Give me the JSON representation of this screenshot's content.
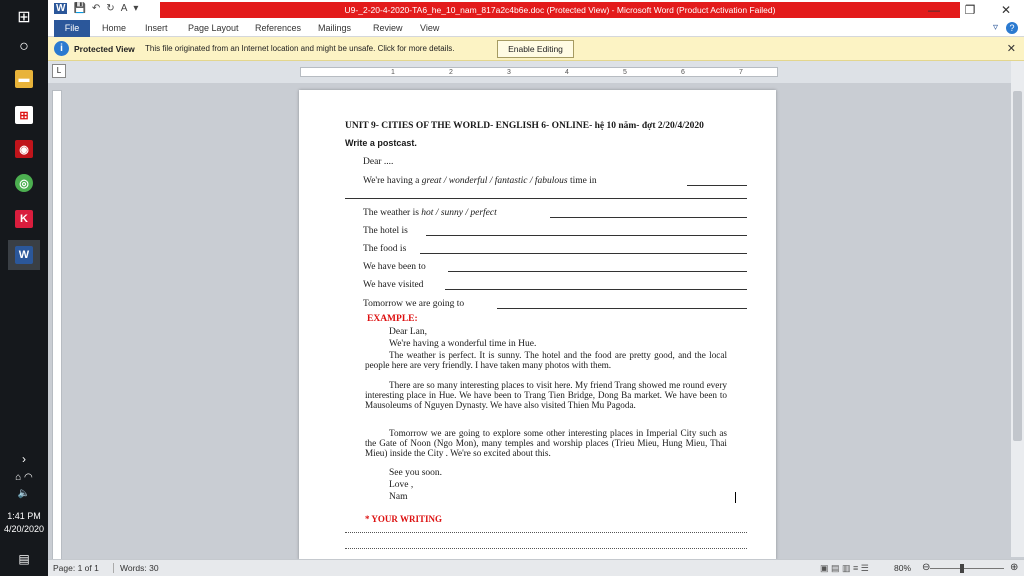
{
  "window": {
    "title": "U9-_2-20-4-2020-TA6_he_10_nam_817a2c4b6e.doc (Protected View) - Microsoft Word (Product Activation Failed)"
  },
  "ribbon": {
    "tabs": [
      "File",
      "Home",
      "Insert",
      "Page Layout",
      "References",
      "Mailings",
      "Review",
      "View"
    ]
  },
  "protected_view": {
    "title": "Protected View",
    "message": "This file originated from an Internet location and might be unsafe. Click for more details.",
    "button": "Enable Editing"
  },
  "ruler": {
    "marks": [
      "1",
      "2",
      "3",
      "4",
      "5",
      "6",
      "7"
    ]
  },
  "document": {
    "heading": "UNIT 9- CITIES OF THE WORLD- ENGLISH 6- ONLINE- hệ 10 năm- đợt 2/20/4/2020",
    "instruction": "Write a postcast.",
    "dear": "Dear ....",
    "having_prefix": "We're having a",
    "having_options": "great / wonderful / fantastic / fabulous",
    "having_suffix": "time in",
    "weather_prefix": "The weather is",
    "weather_options": "hot / sunny / perfect",
    "hotel": "The hotel is",
    "food": "The food is",
    "been_to": "We have been to",
    "visited": "We have visited",
    "tomorrow": "Tomorrow we are going to",
    "example_label": "EXAMPLE:",
    "ex_dear": "Dear Lan,",
    "ex_having": "We're having a  wonderful time in Hue.",
    "ex_para1": "The weather is  perfect. It is sunny. The hotel and the food are pretty good, and the local people here are very friendly. I have taken many photos with them.",
    "ex_para2": "There are so many interesting places to visit here. My friend Trang showed me round every interesting place in Hue. We have been to Trang Tien Bridge, Dong Ba market. We have been to Mausoleums of Nguyen Dynasty. We have also visited Thien Mu Pagoda.",
    "ex_para3": "Tomorrow we are going to explore some other interesting places in Imperial City such as the Gate of Noon (Ngo Mon), many temples and worship places (Trieu Mieu, Hung Mieu, Thai Mieu) inside the City . We're so excited about this.",
    "ex_see": "See you soon.",
    "ex_love": "Love ,",
    "ex_name": "Nam",
    "your_writing": "* YOUR WRITING"
  },
  "status": {
    "page": "Page: 1 of 1",
    "words": "Words: 30",
    "zoom": "80%"
  },
  "taskbar": {
    "time": "1:41 PM",
    "date": "4/20/2020"
  }
}
